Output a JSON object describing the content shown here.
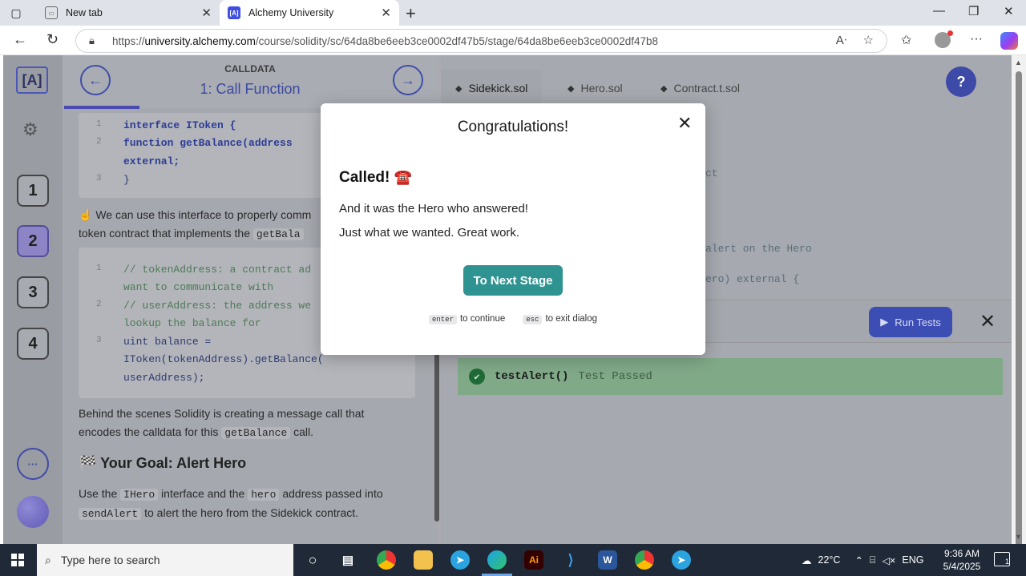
{
  "browser": {
    "tabs": [
      {
        "title": "New tab",
        "icon": "newtab-icon"
      },
      {
        "title": "Alchemy University",
        "icon": "alchemy-favicon",
        "favicon_text": "[A]"
      }
    ],
    "url_prefix": "https://",
    "url_host": "university.alchemy.com",
    "url_path": "/course/solidity/sc/64da8be6eeb3ce0002df47b5/stage/64da8be6eeb3ce0002df47b8"
  },
  "sidebar": {
    "logo": "[A]",
    "steps": [
      "1",
      "2",
      "3",
      "4"
    ],
    "active_step": "2"
  },
  "lesson": {
    "section": "CALLDATA",
    "title": "1: Call Function",
    "code1": [
      {
        "n": "1",
        "text": "interface IToken {"
      },
      {
        "n": "2",
        "text": "    function getBalance(address"
      },
      {
        "n": "",
        "text": "external;"
      },
      {
        "n": "3",
        "text": "}"
      }
    ],
    "para1_pre": "☝️ We can use this interface to properly comm",
    "para1_line2": "token contract that implements the",
    "para1_code": "getBala",
    "code2": [
      {
        "n": "1",
        "text": "// tokenAddress: a contract ad"
      },
      {
        "n": "",
        "text": "want to communicate with"
      },
      {
        "n": "2",
        "text": "// userAddress: the address we"
      },
      {
        "n": "",
        "text": "lookup the balance for"
      },
      {
        "n": "3",
        "text": "uint balance ="
      },
      {
        "n": "",
        "text": "IToken(tokenAddress).getBalance("
      },
      {
        "n": "",
        "text": "userAddress);"
      }
    ],
    "para2_line1": "Behind the scenes Solidity is creating a message call that",
    "para2_line2_pre": "encodes the calldata for this",
    "para2_code": "getBalance",
    "para2_line2_post": "call.",
    "goal_title": "🏁 Your Goal: Alert Hero",
    "para3_a": "Use the",
    "para3_code1": "IHero",
    "para3_b": "interface and the",
    "para3_code2": "hero",
    "para3_c": "address passed into",
    "para3_code3": "sendAlert",
    "para3_d": "to alert the hero from the Sidekick contract."
  },
  "editor": {
    "files": [
      "Sidekick.sol",
      "Hero.sol",
      "Contract.t.sol"
    ],
    "active_file": "Sidekick.sol",
    "help": "?",
    "code_fragments": [
      "ct",
      "alert on the Hero",
      "ero) external {"
    ],
    "run_label": "Run Tests",
    "test": {
      "name": "testAlert()",
      "status": "Test Passed"
    }
  },
  "dialog": {
    "title": "Congratulations!",
    "heading": "Called!",
    "heading_icon": "☎️",
    "line1": "And it was the Hero who answered!",
    "line2": "Just what we wanted. Great work.",
    "button": "To Next Stage",
    "hint1_key": "enter",
    "hint1_text": "to continue",
    "hint2_key": "esc",
    "hint2_text": "to exit dialog"
  },
  "taskbar": {
    "search_placeholder": "Type here to search",
    "weather": "22°C",
    "lang": "ENG",
    "time": "9:36 AM",
    "date": "5/4/2025",
    "notif_count": "1"
  }
}
